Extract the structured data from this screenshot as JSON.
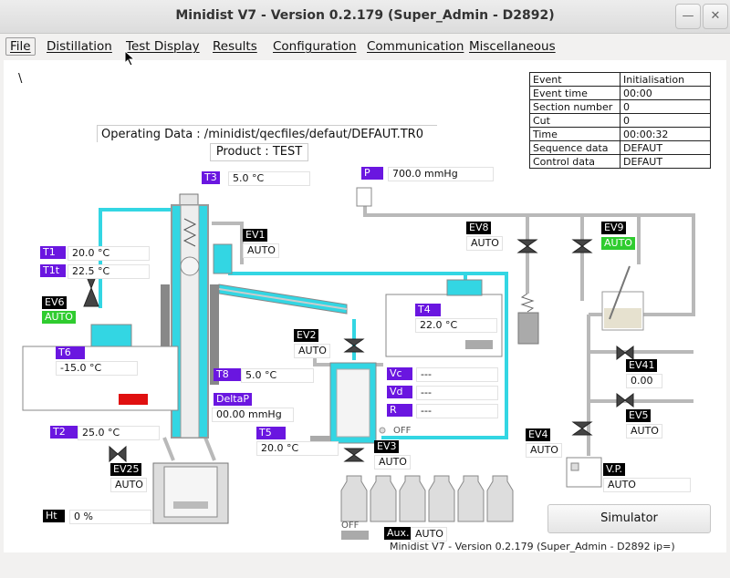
{
  "window": {
    "title": "Minidist V7 - Version 0.2.179   (Super_Admin - D2892)"
  },
  "menu": [
    "File",
    "Distillation",
    "Test Display",
    "Results",
    "Configuration",
    "Communication",
    "Miscellaneous"
  ],
  "top_glyph": "\\",
  "operating": {
    "data": "Operating Data : /minidist/qecfiles/defaut/DEFAUT.TR0",
    "product": "Product : TEST"
  },
  "info_table": [
    {
      "k": "Event",
      "v": "Initialisation"
    },
    {
      "k": "Event time",
      "v": "00:00"
    },
    {
      "k": "Section number",
      "v": "0"
    },
    {
      "k": "Cut",
      "v": "0"
    },
    {
      "k": "Time",
      "v": "00:00:32"
    },
    {
      "k": "Sequence data",
      "v": "DEFAUT"
    },
    {
      "k": "Control data",
      "v": "DEFAUT"
    }
  ],
  "sensors": {
    "T3": {
      "label": "T3",
      "value": "5.0 °C"
    },
    "P": {
      "label": "P",
      "value": "700.0 mmHg"
    },
    "T1": {
      "label": "T1",
      "value": "20.0 °C"
    },
    "T1t": {
      "label": "T1t",
      "value": "22.5 °C"
    },
    "T6": {
      "label": "T6",
      "value": "-15.0 °C"
    },
    "T4": {
      "label": "T4",
      "value": "22.0 °C"
    },
    "T8": {
      "label": "T8",
      "value": "5.0 °C"
    },
    "DeltaP": {
      "label": "DeltaP",
      "value": "00.00 mmHg"
    },
    "T2": {
      "label": "T2",
      "value": "25.0 °C"
    },
    "T5": {
      "label": "T5",
      "value": "20.0 °C"
    },
    "Vc": {
      "label": "Vc",
      "value": "---"
    },
    "Vd": {
      "label": "Vd",
      "value": "---"
    },
    "R": {
      "label": "R",
      "value": "---"
    },
    "Ht": {
      "label": "Ht",
      "value": "0 %"
    }
  },
  "valves": {
    "EV1": {
      "label": "EV1",
      "state": "AUTO"
    },
    "EV6": {
      "label": "EV6",
      "state": "AUTO"
    },
    "EV2": {
      "label": "EV2",
      "state": "AUTO"
    },
    "EV8": {
      "label": "EV8",
      "state": "AUTO"
    },
    "EV9": {
      "label": "EV9",
      "state": "AUTO"
    },
    "EV41": {
      "label": "EV41",
      "state": "0.00"
    },
    "EV5": {
      "label": "EV5",
      "state": "AUTO"
    },
    "EV4": {
      "label": "EV4",
      "state": "AUTO"
    },
    "VP": {
      "label": "V.P.",
      "state": "AUTO"
    },
    "EV3": {
      "label": "EV3",
      "state": "AUTO"
    },
    "EV25": {
      "label": "EV25",
      "state": "AUTO"
    },
    "Aux": {
      "label": "Aux.",
      "state": "AUTO"
    }
  },
  "off_labels": {
    "receiver": "OFF",
    "bottles": "OFF"
  },
  "simulator_label": "Simulator",
  "status_line": "Minidist V7 - Version 0.2.179   (Super_Admin - D2892  ip=)",
  "colors": {
    "fluid": "#33d6e3",
    "label_bg": "#6a16e0",
    "auto_green": "#2fcc2f",
    "alarm_red": "#e01010",
    "pipe": "#bbbbbb"
  }
}
